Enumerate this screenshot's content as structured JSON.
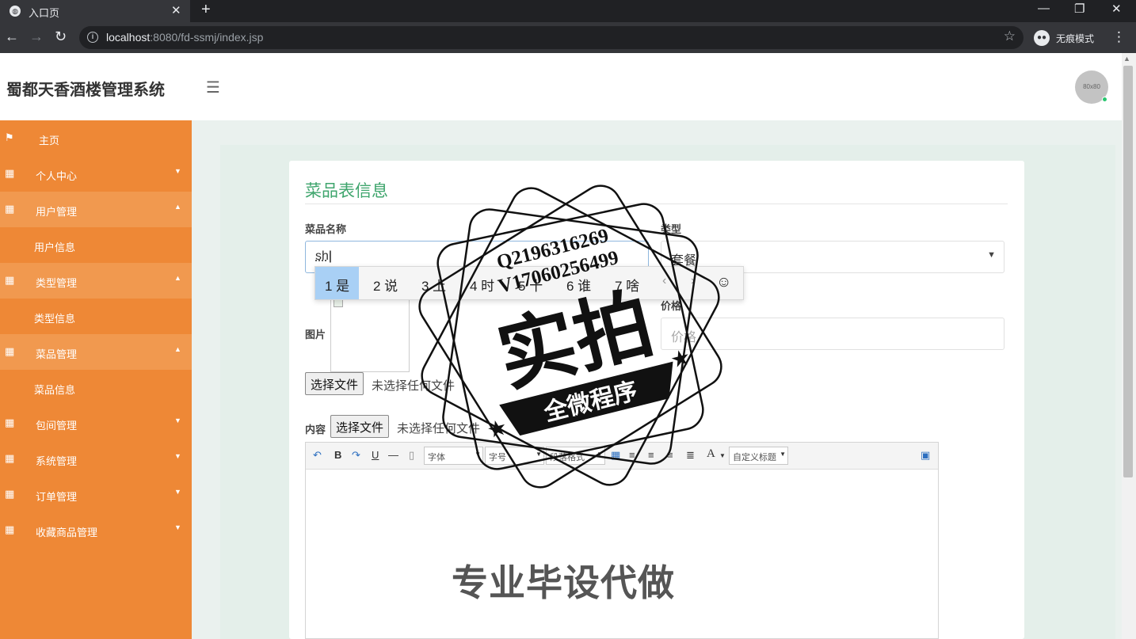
{
  "browser": {
    "tab_title": "入口页",
    "tab_icon": "globe-icon",
    "url_host": "localhost",
    "url_rest": ":8080/fd-ssmj/index.jsp",
    "mode_label": "无痕模式"
  },
  "app": {
    "title": "蜀都天香酒楼管理系统",
    "avatar_text": "80x80"
  },
  "sidebar": {
    "accent_color": "#ee8836",
    "items": [
      {
        "label": "主页",
        "icon": "flag-icon"
      },
      {
        "label": "个人中心",
        "icon": "grid-icon"
      },
      {
        "label": "用户管理",
        "icon": "grid-icon",
        "open": true
      },
      {
        "label": "用户信息"
      },
      {
        "label": "类型管理",
        "icon": "grid-icon",
        "open": true
      },
      {
        "label": "类型信息"
      },
      {
        "label": "菜品管理",
        "icon": "grid-icon",
        "open": true
      },
      {
        "label": "菜品信息"
      },
      {
        "label": "包间管理",
        "icon": "grid-icon"
      },
      {
        "label": "系统管理",
        "icon": "grid-icon"
      },
      {
        "label": "订单管理",
        "icon": "grid-icon"
      },
      {
        "label": "收藏商品管理",
        "icon": "grid-icon"
      }
    ]
  },
  "form": {
    "title": "菜品表信息",
    "title_color": "#3fa56d",
    "name_label": "菜品名称",
    "name_value": "sh",
    "type_label": "类型",
    "type_value": "套餐",
    "image_label": "图片",
    "price_label": "价格",
    "price_placeholder": "价格",
    "file_button": "选择文件",
    "file_status": "未选择任何文件",
    "content_label": "内容"
  },
  "editor": {
    "font_select": "字体",
    "size_select": "字号",
    "paragraph_select": "段落格式",
    "custom_title_select": "自定义标题",
    "bold": "B",
    "underline": "U",
    "font_color": "A"
  },
  "ime": {
    "candidates": [
      "1 是",
      "2 说",
      "3 上",
      "4 时",
      "5 十",
      "6 谁",
      "7 啥"
    ]
  },
  "watermark": {
    "qq": "Q2196316269",
    "wechat": "V17060256499",
    "big_text": "实拍",
    "banner_text": "全微程序",
    "bottom_text": "专业毕设代做"
  }
}
